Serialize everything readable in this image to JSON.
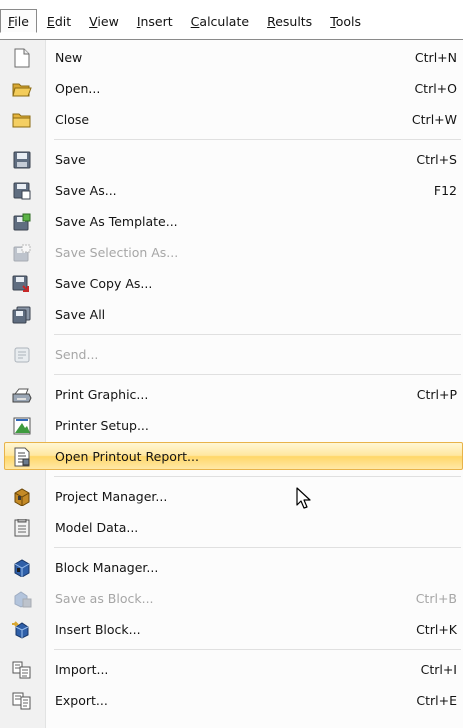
{
  "menubar": {
    "items": [
      {
        "pre": "",
        "mn": "F",
        "post": "ile"
      },
      {
        "pre": "",
        "mn": "E",
        "post": "dit"
      },
      {
        "pre": "",
        "mn": "V",
        "post": "iew"
      },
      {
        "pre": "",
        "mn": "I",
        "post": "nsert"
      },
      {
        "pre": "",
        "mn": "C",
        "post": "alculate"
      },
      {
        "pre": "",
        "mn": "R",
        "post": "esults"
      },
      {
        "pre": "",
        "mn": "T",
        "post": "ools"
      }
    ]
  },
  "menu": {
    "new": {
      "label": "New",
      "shortcut": "Ctrl+N"
    },
    "open": {
      "label": "Open...",
      "shortcut": "Ctrl+O"
    },
    "close": {
      "label": "Close",
      "shortcut": "Ctrl+W"
    },
    "save": {
      "label": "Save",
      "shortcut": "Ctrl+S"
    },
    "save_as": {
      "label": "Save As...",
      "shortcut": "F12"
    },
    "save_as_template": {
      "label": "Save As Template...",
      "shortcut": ""
    },
    "save_selection_as": {
      "label": "Save Selection As...",
      "shortcut": ""
    },
    "save_copy_as": {
      "label": "Save Copy As...",
      "shortcut": ""
    },
    "save_all": {
      "label": "Save All",
      "shortcut": ""
    },
    "send": {
      "label": "Send...",
      "shortcut": ""
    },
    "print_graphic": {
      "label": "Print Graphic...",
      "shortcut": "Ctrl+P"
    },
    "printer_setup": {
      "label": "Printer Setup...",
      "shortcut": ""
    },
    "open_printout_report": {
      "label": "Open Printout Report...",
      "shortcut": ""
    },
    "project_manager": {
      "label": "Project Manager...",
      "shortcut": ""
    },
    "model_data": {
      "label": "Model Data...",
      "shortcut": ""
    },
    "block_manager": {
      "label": "Block Manager...",
      "shortcut": ""
    },
    "save_as_block": {
      "label": "Save as Block...",
      "shortcut": "Ctrl+B"
    },
    "insert_block": {
      "label": "Insert Block...",
      "shortcut": "Ctrl+K"
    },
    "import": {
      "label": "Import...",
      "shortcut": "Ctrl+I"
    },
    "export": {
      "label": "Export...",
      "shortcut": "Ctrl+E"
    }
  },
  "colors": {
    "highlight_border": "#e8b34a",
    "highlight_fill": "#ffd768",
    "disabled_text": "#a6a6a6",
    "gutter": "#f1f1f1"
  },
  "icons": {
    "new": "new-document-icon",
    "open": "open-folder-icon",
    "close": "close-folder-icon",
    "save": "floppy-disk-icon",
    "save_as": "floppy-save-as-icon",
    "save_as_template": "floppy-template-icon",
    "save_selection_as": "floppy-selection-icon",
    "save_copy_as": "floppy-copy-icon",
    "save_all": "floppy-stack-icon",
    "send": "send-mail-icon",
    "print_graphic": "printer-icon",
    "printer_setup": "printer-setup-icon",
    "open_printout_report": "report-document-icon",
    "project_manager": "project-manager-icon",
    "model_data": "model-data-icon",
    "block_manager": "block-manager-icon",
    "save_as_block": "save-block-icon",
    "insert_block": "insert-block-icon",
    "import": "import-icon",
    "export": "export-icon"
  }
}
